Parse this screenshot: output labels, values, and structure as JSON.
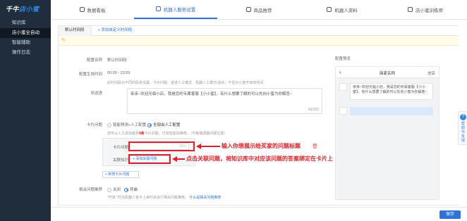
{
  "sidebar": {
    "logo_a": "千牛",
    "logo_b": "店小蜜",
    "items": [
      {
        "label": "知识库"
      },
      {
        "label": "店小蜜全自动"
      },
      {
        "label": "智能辅助"
      },
      {
        "label": "操作日志"
      }
    ]
  },
  "topnav": {
    "tabs": [
      {
        "label": "数据看板"
      },
      {
        "label": "机器人服务设置"
      },
      {
        "label": "商品推荐"
      },
      {
        "label": "机器人资料"
      },
      {
        "label": "店小蜜训练师"
      }
    ]
  },
  "subtabs": {
    "default": "默认时间段",
    "add": "+ 添加自定义时间段"
  },
  "form": {
    "config_name_label": "配置名称",
    "config_name_value": "默认时间段",
    "config_time_label": "配置生效时间",
    "config_time_value": "00:00 - 23:59",
    "time_note": "此时间段为不同时段未设置、卡片问题、首选人工模式、机器人工模式/话术；不显示小蜜开启的时间",
    "welcome_label": "欢迎语",
    "welcome_text": "亲亲~欢迎光临小店，我是您的专属客服【小小蜜】，有什么想要了解的可以先向小蜜为你解答~",
    "welcome_count": "43/150",
    "card_label": "卡片问题",
    "radio_a": "智能预测+人工配置",
    "radio_b": "全部由人工配置",
    "card_hint_1": "您可以人工添加最多",
    "card_hint_num": "9条",
    "card_hint_2": "卡片问题，已有智能加推荐。（可拖拽调整问题位置）",
    "card_question_label": "卡片问题",
    "card_question_count": "0/15",
    "related_label": "关联知识",
    "related_btn": "+ 添加关联问题",
    "add_card_btn": "+ 新增卡片问题",
    "recommend_label": "相关问题推荐",
    "recommend_off": "关闭",
    "recommend_on": "开启",
    "recommend_note": "\"开启\" 时当机器人答不上来时会进行相关问题推荐。",
    "recommend_link": "什么是相关问题推荐"
  },
  "annotations": {
    "a1": "输入你想展示给买家的问题标题",
    "a2": "点击关联问题，将知识库中对应该问题的答案绑定在卡片上"
  },
  "preview": {
    "title": "配置预览",
    "shop_name": "商家名称",
    "enter": "进店",
    "bubble": "亲亲~欢迎光临小店，我是您的专属客服【小小蜜】，有什么想要了解的可以先向小蜜为你解答~"
  },
  "float": {
    "icon": "?",
    "text": "帮助与反馈"
  },
  "footer": {
    "save": "保存"
  },
  "colors": {
    "accent": "#2f72d8",
    "sidebar_bg": "#1f2d3d",
    "annotation_red": "#d9232a"
  }
}
